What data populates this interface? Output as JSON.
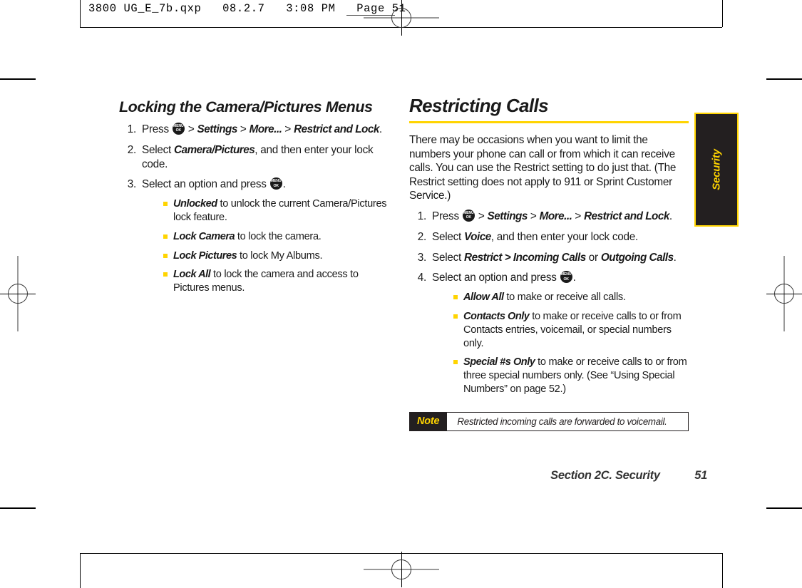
{
  "prepress": {
    "header_line": "3800 UG_E_7b.qxp   08.2.7   3:08 PM   Page 51",
    "corner_page_number": "51"
  },
  "thumb_tab": {
    "label": "Security",
    "background": "#231f20",
    "border_color": "#ffd400",
    "text_color": "#ffd400"
  },
  "accent_color": "#ffd400",
  "left_column": {
    "title": "Locking the Camera/Pictures Menus",
    "steps": [
      {
        "num": "1.",
        "parts": [
          {
            "type": "text",
            "text": "Press "
          },
          {
            "type": "menukey"
          },
          {
            "type": "text",
            "text": " > "
          },
          {
            "type": "italic",
            "text": "Settings"
          },
          {
            "type": "text",
            "text": " > "
          },
          {
            "type": "italic",
            "text": "More..."
          },
          {
            "type": "text",
            "text": " > "
          },
          {
            "type": "italic",
            "text": "Restrict and Lock"
          },
          {
            "type": "text",
            "text": "."
          }
        ]
      },
      {
        "num": "2.",
        "parts": [
          {
            "type": "text",
            "text": "Select "
          },
          {
            "type": "italic",
            "text": "Camera/Pictures"
          },
          {
            "type": "text",
            "text": ", and then enter your lock code."
          }
        ]
      },
      {
        "num": "3.",
        "parts": [
          {
            "type": "text",
            "text": "Select an option and press "
          },
          {
            "type": "menukey"
          },
          {
            "type": "text",
            "text": "."
          }
        ],
        "bullets": [
          [
            {
              "type": "italic",
              "text": "Unlocked"
            },
            {
              "type": "text",
              "text": " to unlock the current Camera/Pictures lock feature."
            }
          ],
          [
            {
              "type": "italic",
              "text": "Lock Camera"
            },
            {
              "type": "text",
              "text": " to lock the camera."
            }
          ],
          [
            {
              "type": "italic",
              "text": "Lock Pictures"
            },
            {
              "type": "text",
              "text": " to lock My Albums."
            }
          ],
          [
            {
              "type": "italic",
              "text": "Lock All"
            },
            {
              "type": "text",
              "text": " to lock the camera and access to Pictures menus."
            }
          ]
        ]
      }
    ]
  },
  "right_column": {
    "title": "Restricting Calls",
    "intro": "There may be occasions when you want to limit the numbers your phone can call or from which it can receive calls. You can use the Restrict setting to do just that. (The Restrict setting does not apply to 911 or Sprint Customer Service.)",
    "steps": [
      {
        "num": "1.",
        "parts": [
          {
            "type": "text",
            "text": "Press "
          },
          {
            "type": "menukey"
          },
          {
            "type": "text",
            "text": " > "
          },
          {
            "type": "italic",
            "text": "Settings"
          },
          {
            "type": "text",
            "text": " > "
          },
          {
            "type": "italic",
            "text": "More..."
          },
          {
            "type": "text",
            "text": " > "
          },
          {
            "type": "italic",
            "text": "Restrict and Lock"
          },
          {
            "type": "text",
            "text": "."
          }
        ]
      },
      {
        "num": "2.",
        "parts": [
          {
            "type": "text",
            "text": "Select "
          },
          {
            "type": "italic",
            "text": "Voice"
          },
          {
            "type": "text",
            "text": ", and then enter your lock code."
          }
        ]
      },
      {
        "num": "3.",
        "parts": [
          {
            "type": "text",
            "text": "Select "
          },
          {
            "type": "italic",
            "text": "Restrict > Incoming Calls"
          },
          {
            "type": "text",
            "text": " or "
          },
          {
            "type": "italic",
            "text": "Outgoing Calls"
          },
          {
            "type": "text",
            "text": "."
          }
        ]
      },
      {
        "num": "4.",
        "parts": [
          {
            "type": "text",
            "text": "Select an option and press "
          },
          {
            "type": "menukey"
          },
          {
            "type": "text",
            "text": "."
          }
        ],
        "bullets": [
          [
            {
              "type": "italic",
              "text": "Allow All"
            },
            {
              "type": "text",
              "text": " to make or receive all calls."
            }
          ],
          [
            {
              "type": "italic",
              "text": "Contacts Only"
            },
            {
              "type": "text",
              "text": " to make or receive calls to or from Contacts entries, voicemail, or special numbers only."
            }
          ],
          [
            {
              "type": "italic",
              "text": "Special #s Only"
            },
            {
              "type": "text",
              "text": " to make or receive calls to or from three special numbers only. (See “Using Special Numbers” on page 52.)"
            }
          ]
        ]
      }
    ],
    "note": {
      "label": "Note",
      "text": "Restricted incoming calls are forwarded to voicemail."
    }
  },
  "footer": {
    "section": "Section 2C. Security",
    "page": "51"
  },
  "menukey_glyph": {
    "top": "MENU",
    "bottom": "OK"
  }
}
